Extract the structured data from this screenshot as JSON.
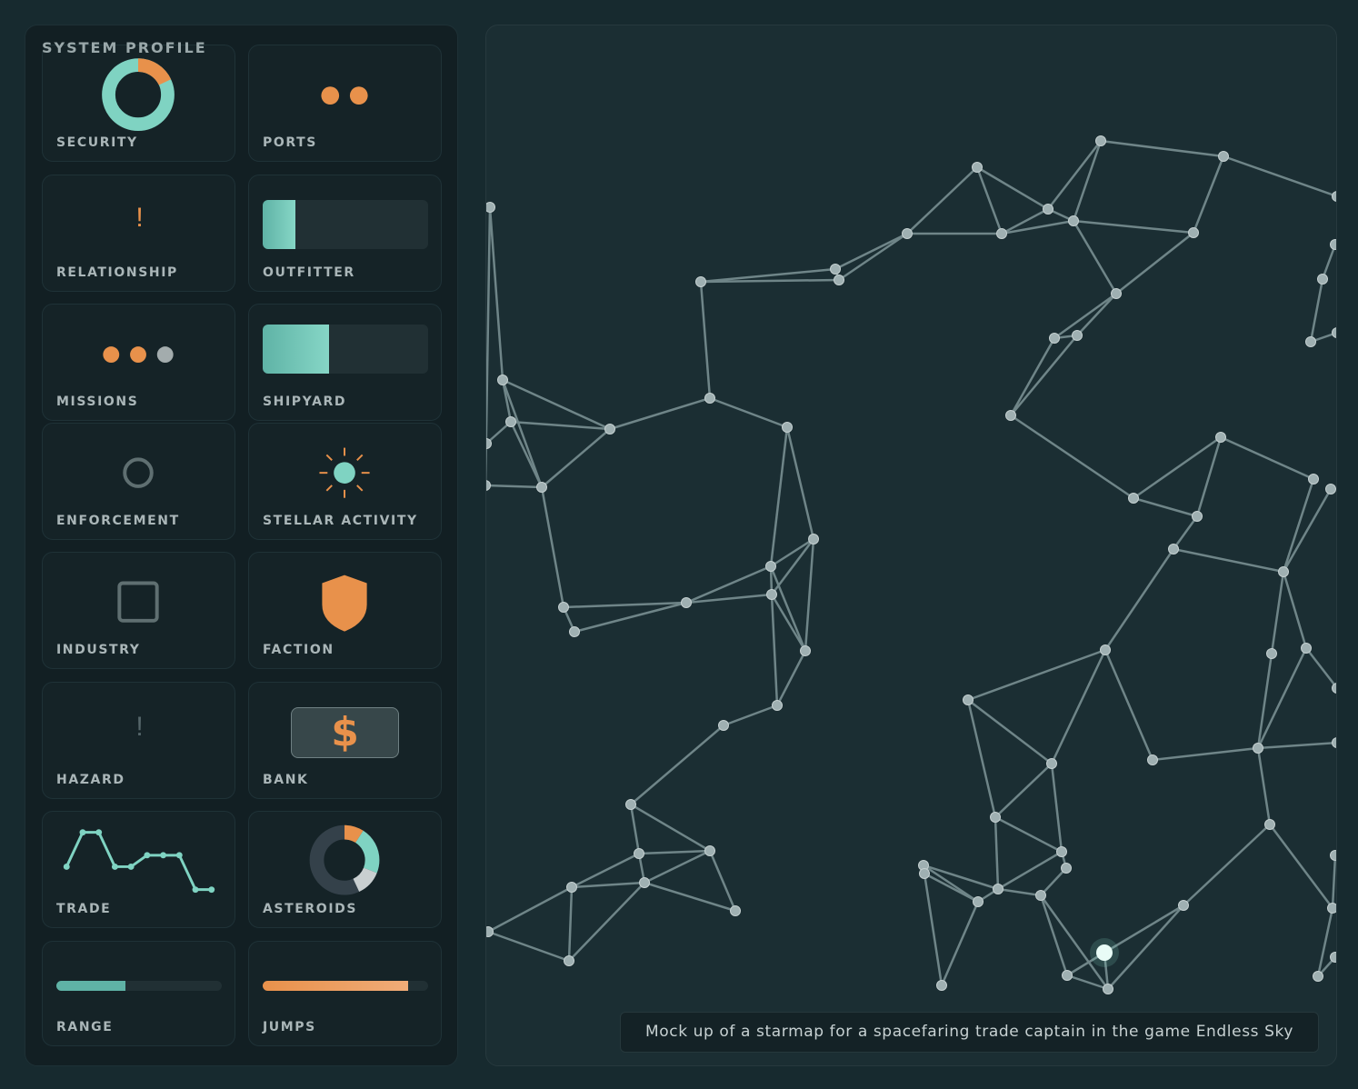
{
  "panel": {
    "title": "SYSTEM PROFILE"
  },
  "cards": {
    "security": {
      "label": "SECURITY",
      "donut_fraction_orange": 0.18
    },
    "ports": {
      "label": "PORTS",
      "count": 2
    },
    "relationship": {
      "label": "RELATIONSHIP",
      "glyph": "!"
    },
    "outfitter": {
      "label": "OUTFITTER",
      "level": 0.2
    },
    "missions": {
      "label": "MISSIONS",
      "dots": [
        "orange",
        "orange",
        "grey"
      ]
    },
    "shipyard": {
      "label": "SHIPYARD",
      "level": 0.4
    },
    "enforcement": {
      "label": "ENFORCEMENT",
      "icon": "circle-outline-icon"
    },
    "stellar_activity": {
      "label": "STELLAR ACTIVITY",
      "icon": "sun-icon"
    },
    "industry": {
      "label": "INDUSTRY",
      "icon": "square-outline-icon"
    },
    "faction": {
      "label": "FACTION",
      "icon": "shield-icon"
    },
    "hazard": {
      "label": "HAZARD",
      "glyph": "!"
    },
    "bank": {
      "label": "BANK",
      "glyph": "$"
    },
    "trade": {
      "label": "TRADE",
      "trend": [
        2,
        5,
        5,
        2,
        2,
        3,
        3,
        3,
        0,
        0
      ]
    },
    "asteroids": {
      "label": "ASTEROIDS",
      "segments": [
        0.09,
        0.22,
        0.12
      ]
    },
    "range": {
      "label": "RANGE",
      "level": 0.42
    },
    "jumps": {
      "label": "JUMPS",
      "level": 0.88
    }
  },
  "map": {
    "caption": "Mock up of a starmap for a spacefaring trade captain in the game Endless Sky"
  },
  "colors": {
    "accent_teal": "#7fd3c2",
    "accent_orange": "#e8914b",
    "panel_bg": "#121f23",
    "map_bg": "#1b2e33",
    "node": "#9fb0b2",
    "edge": "#6f8588"
  }
}
